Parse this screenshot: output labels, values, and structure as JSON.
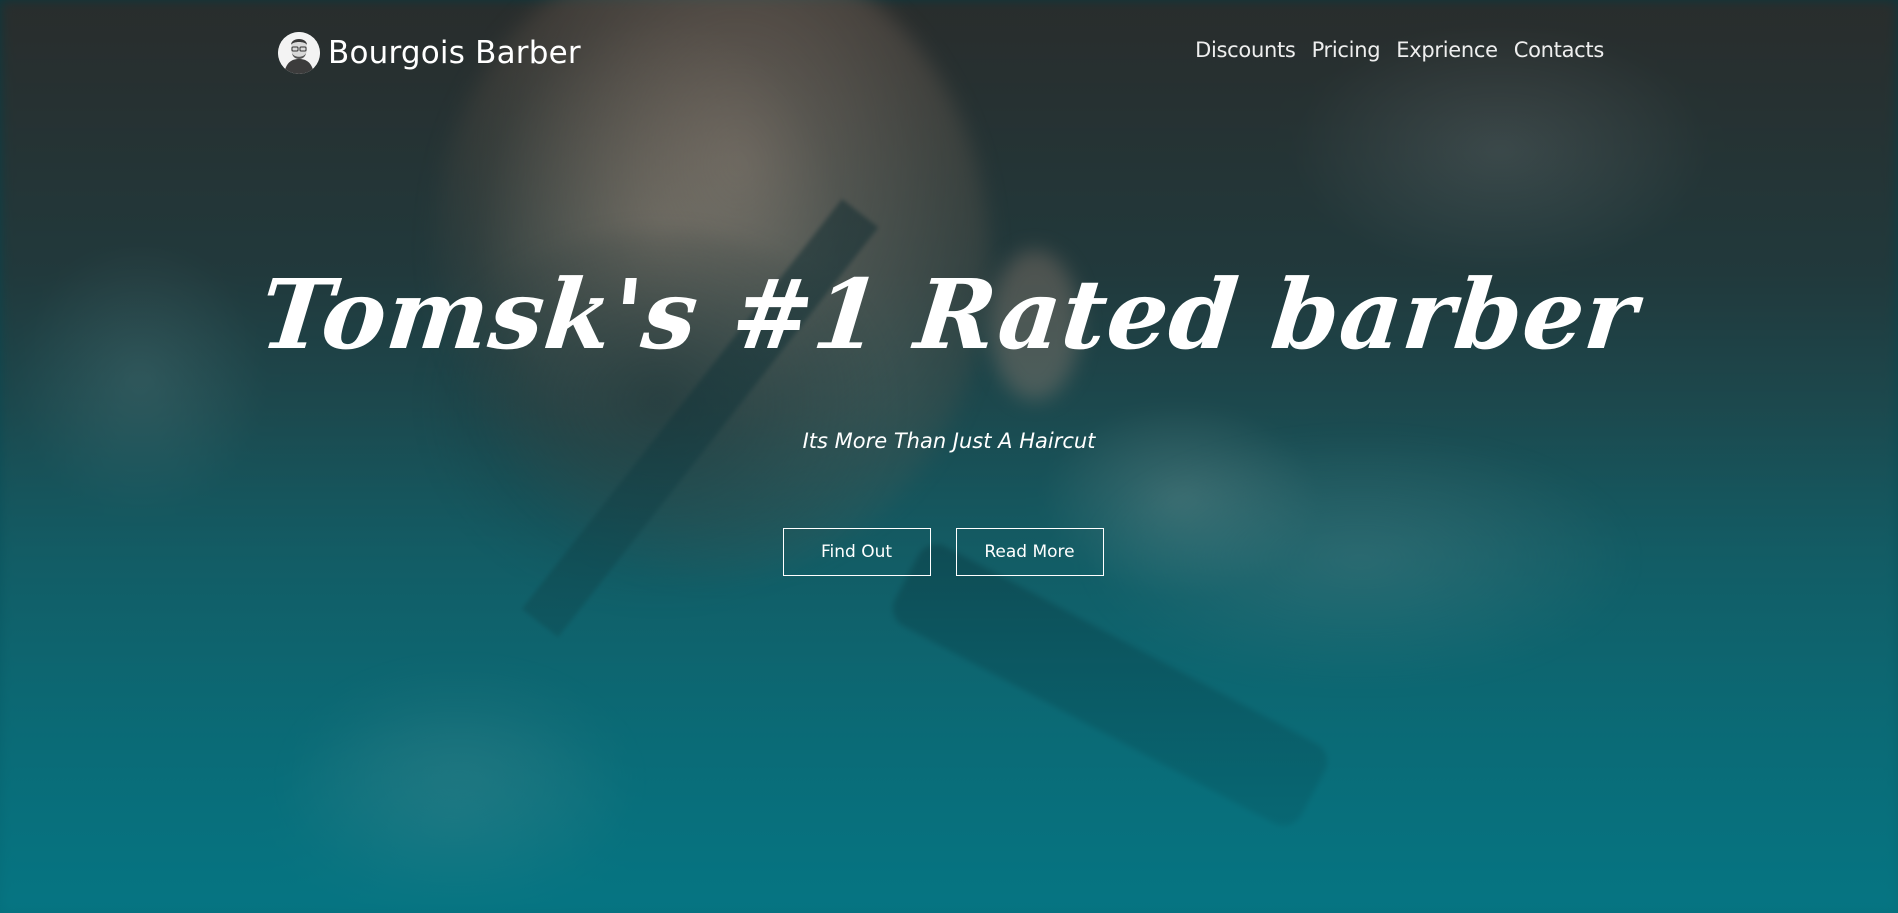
{
  "header": {
    "brand_name": "Bourgois Barber",
    "logo_icon": "barber-avatar-icon",
    "nav_items": [
      {
        "label": "Discounts"
      },
      {
        "label": "Pricing"
      },
      {
        "label": "Exprience"
      },
      {
        "label": "Contacts"
      }
    ]
  },
  "hero": {
    "headline": "Tomsk's #1 Rated barber",
    "tagline": "Its More Than Just A Haircut",
    "buttons": {
      "find_out_label": "Find Out",
      "read_more_label": "Read More"
    },
    "background": "blurred-barber-photo",
    "overlay_color": "#05808e"
  },
  "colors": {
    "text": "#ffffff",
    "accent_teal": "#0a7f8c"
  }
}
